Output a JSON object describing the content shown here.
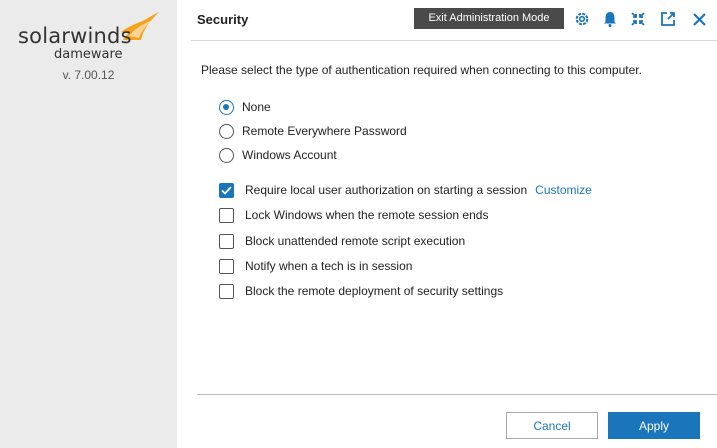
{
  "sidebar": {
    "logo_text": "solarwinds",
    "logo_subtext": "dameware",
    "version": "v. 7.00.12"
  },
  "header": {
    "title": "Security",
    "exit_admin_label": "Exit Administration Mode",
    "icons": [
      "gear-icon",
      "bell-icon",
      "collapse-icon",
      "external-link-icon",
      "close-icon"
    ]
  },
  "content": {
    "prompt": "Please select the type of authentication required when connecting to this computer.",
    "auth_options": [
      {
        "label": "None",
        "checked": true
      },
      {
        "label": "Remote Everywhere Password",
        "checked": false
      },
      {
        "label": "Windows Account",
        "checked": false
      }
    ],
    "options": [
      {
        "label": "Require local user authorization on starting a session",
        "checked": true,
        "link": "Customize"
      },
      {
        "label": "Lock Windows when the remote session ends",
        "checked": false
      },
      {
        "label": "Block unattended remote script execution",
        "checked": false
      },
      {
        "label": "Notify when a tech is in session",
        "checked": false
      },
      {
        "label": "Block the remote deployment of security settings",
        "checked": false
      }
    ]
  },
  "footer": {
    "cancel_label": "Cancel",
    "apply_label": "Apply"
  },
  "colors": {
    "accent": "#1a75bb",
    "sidebar_bg": "#ebebeb",
    "logo_orange": "#f7a21b",
    "exit_btn_bg": "#4a4a4a"
  }
}
